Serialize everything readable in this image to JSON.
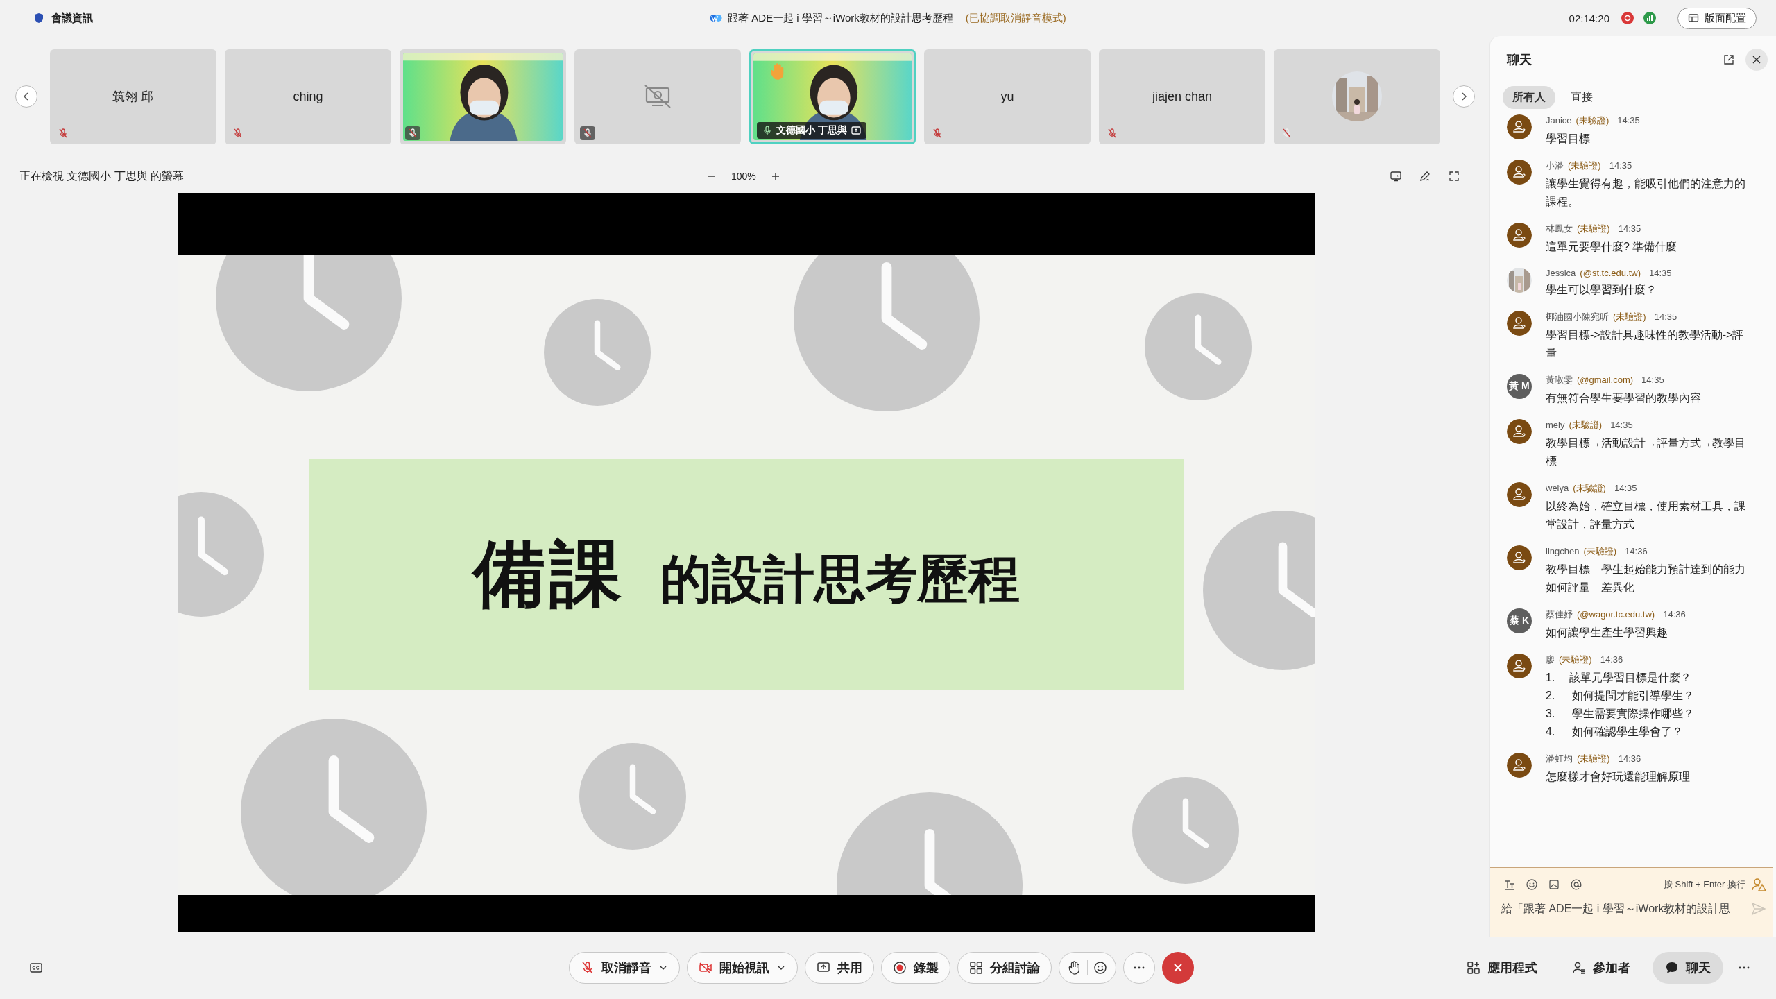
{
  "top_bar": {
    "meeting_info": "會議資訊",
    "title": "跟著 ADE一起 i 學習～iWork教材的設計思考歷程",
    "title_note": "(已協調取消靜音模式)",
    "time": "02:14:20",
    "layout_button": "版面配置"
  },
  "participants": [
    {
      "kind": "name",
      "name": "筑翎 邱",
      "muted": true,
      "selected": false
    },
    {
      "kind": "name",
      "name": "ching",
      "muted": true,
      "selected": false
    },
    {
      "kind": "video",
      "muted": true,
      "selected": false
    },
    {
      "kind": "camera_off",
      "muted": true,
      "selected": false
    },
    {
      "kind": "video",
      "name": "文德國小 丁思與",
      "hand_raised": true,
      "muted": false,
      "selected": true
    },
    {
      "kind": "name",
      "name": "yu",
      "muted": true,
      "selected": false
    },
    {
      "kind": "name",
      "name": "jiajen chan",
      "muted": true,
      "selected": false
    },
    {
      "kind": "avatar",
      "muted": true,
      "selected": false
    }
  ],
  "view": {
    "caption": "正在檢視 文德國小 丁思與 的螢幕",
    "zoom": "100%"
  },
  "slide": {
    "title_big": "備課",
    "title_rest": "的設計思考歷程"
  },
  "chat": {
    "title": "聊天",
    "tabs": [
      {
        "label": "所有人",
        "selected": true
      },
      {
        "label": "直接",
        "selected": false
      }
    ],
    "messages": [
      {
        "sender": "Janice",
        "tag": "(未驗證)",
        "time": "14:35",
        "kind": "generic",
        "lines": [
          "學習目標"
        ]
      },
      {
        "sender": "小潘",
        "tag": "(未驗證)",
        "time": "14:35",
        "kind": "generic",
        "lines": [
          "讓學生覺得有趣，能吸引他們的注意力的課程。"
        ]
      },
      {
        "sender": "林鳳女",
        "tag": "(未驗證)",
        "time": "14:35",
        "kind": "generic",
        "lines": [
          "這單元要學什麼? 準備什麼"
        ]
      },
      {
        "sender": "Jessica",
        "tag": "(@st.tc.edu.tw)",
        "time": "14:35",
        "kind": "picture",
        "lines": [
          "學生可以學習到什麼？"
        ]
      },
      {
        "sender": "椰油國小陳宛昕",
        "tag": "(未驗證)",
        "time": "14:35",
        "kind": "generic",
        "lines": [
          "學習目標->設計具趣味性的教學活動->評量"
        ]
      },
      {
        "sender": "黃琡雯",
        "tag": "(@gmail.com)",
        "time": "14:35",
        "kind": "initials",
        "initials": "黃 M",
        "lines": [
          "有無符合學生要學習的教學內容"
        ]
      },
      {
        "sender": "mely",
        "tag": "(未驗證)",
        "time": "14:35",
        "kind": "generic",
        "lines": [
          "教學目標→活動設計→評量方式→教學目標"
        ]
      },
      {
        "sender": "weiya",
        "tag": "(未驗證)",
        "time": "14:35",
        "kind": "generic",
        "lines": [
          "以終為始，確立目標，使用素材工具，課堂設計，評量方式"
        ]
      },
      {
        "sender": "lingchen",
        "tag": "(未驗證)",
        "time": "14:36",
        "kind": "generic",
        "lines": [
          "教學目標　學生起始能力預計達到的能力",
          "如何評量　差異化"
        ]
      },
      {
        "sender": "蔡佳妤",
        "tag": "(@wagor.tc.edu.tw)",
        "time": "14:36",
        "kind": "initials",
        "initials": "蔡 K",
        "lines": [
          "如何讓學生產生學習興趣"
        ]
      },
      {
        "sender": "廖",
        "tag": "(未驗證)",
        "time": "14:36",
        "kind": "generic",
        "lines": [
          "1.　 該單元學習目標是什麼？",
          "2.　  如何提問才能引導學生？",
          "3.　  學生需要實際操作哪些？",
          "4.　  如何確認學生學會了？"
        ]
      },
      {
        "sender": "潘虹均",
        "tag": "(未驗證)",
        "time": "14:36",
        "kind": "generic",
        "lines": [
          "怎麼樣才會好玩還能理解原理"
        ]
      }
    ],
    "composer": {
      "hint": "按 Shift + Enter 換行",
      "placeholder": "給「跟著 ADE一起 i 學習～iWork教材的設計思"
    }
  },
  "toolbar": {
    "buttons": [
      {
        "kind": "mic_off",
        "label": "取消靜音",
        "dropdown": true
      },
      {
        "kind": "video_off",
        "label": "開始視訊",
        "dropdown": true
      },
      {
        "kind": "share",
        "label": "共用",
        "dropdown": false
      },
      {
        "kind": "record",
        "label": "錄製",
        "dropdown": false
      },
      {
        "kind": "breakout",
        "label": "分組討論",
        "dropdown": false
      }
    ],
    "right": [
      {
        "kind": "apps",
        "label": "應用程式",
        "selected": false
      },
      {
        "kind": "participants",
        "label": "參加者",
        "selected": false
      },
      {
        "kind": "chat",
        "label": "聊天",
        "selected": true
      }
    ]
  }
}
